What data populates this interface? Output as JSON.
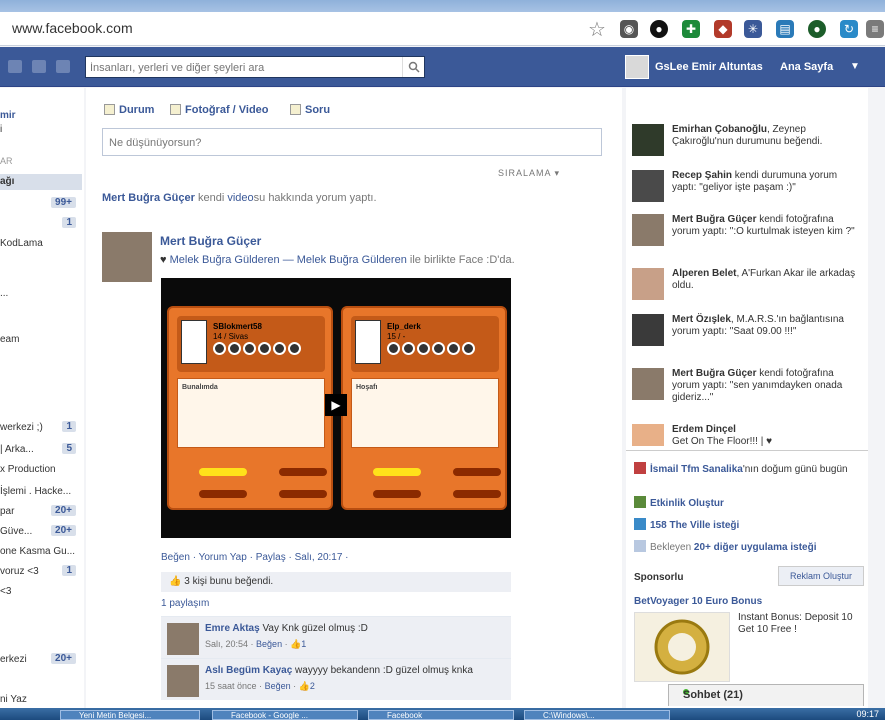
{
  "browser": {
    "url": "www.facebook.com"
  },
  "topbar": {
    "search_placeholder": "İnsanları, yerleri ve diğer şeyleri ara",
    "profile_name": "GsLee Emir Altuntas",
    "home_label": "Ana Sayfa"
  },
  "left": {
    "rows": [
      {
        "label": "mir",
        "count": ""
      },
      {
        "label": "i",
        "count": ""
      },
      {
        "label": "AR",
        "count": ""
      },
      {
        "label": "ağı",
        "count": ""
      },
      {
        "label": "",
        "count": "99+"
      },
      {
        "label": "",
        "count": "1"
      },
      {
        "label": "KodLama",
        "count": ""
      },
      {
        "label": "",
        "count": ""
      },
      {
        "label": "...",
        "count": ""
      },
      {
        "label": "eam",
        "count": ""
      },
      {
        "label": "werkezi ;)",
        "count": "1"
      },
      {
        "label": "| Arka...",
        "count": "5"
      },
      {
        "label": "x Production",
        "count": ""
      },
      {
        "label": "İşlemi . Hacke...",
        "count": ""
      },
      {
        "label": "par",
        "count": "20+"
      },
      {
        "label": "Güve...",
        "count": "20+"
      },
      {
        "label": "one Kasma Gu...",
        "count": ""
      },
      {
        "label": "voruz <3",
        "count": "1"
      },
      {
        "label": "<3",
        "count": ""
      },
      {
        "label": "erkezi",
        "count": "20+"
      },
      {
        "label": "ni Yaz",
        "count": ""
      }
    ]
  },
  "composer": {
    "tab_status": "Durum",
    "tab_photo": "Fotoğraf / Video",
    "tab_question": "Soru",
    "placeholder": "Ne düşünüyorsun?",
    "sort_label": "SIRALAMA"
  },
  "story1": {
    "actor": "Mert Buğra Güçer",
    "text_a": "kendi",
    "link": "video",
    "text_b": "su hakkında yorum yaptı."
  },
  "post": {
    "author": "Mert Buğra Güçer",
    "with_prefix": "♥",
    "with_link": "Melek Buğra Gülderen — Melek Buğra Gülderen",
    "with_suffix": "ile birlikte Face :D'da.",
    "video_left_name": "SBlokmert58",
    "video_left_level": "14 / Sivas",
    "video_right_name": "Elp_derk",
    "video_right_level": "15 / -",
    "video_left_section": "Bunalımda",
    "video_right_section": "Hoşafı",
    "actions": "Beğen · Yorum Yap · Paylaş · Salı, 20:17 ·",
    "likes": "3 kişi bunu beğendi.",
    "likes_link": "3 kişi",
    "shares": "1 paylaşım",
    "comments": [
      {
        "author": "Emre Aktaş",
        "text": "Vay Knk güzel olmuş :D",
        "meta": "Salı, 20:54 ·",
        "like": "Beğen",
        "count": "1"
      },
      {
        "author": "Aslı Begüm Kayaç",
        "text": "wayyyy bekandenn :D güzel olmuş knka",
        "meta": "15 saat önce ·",
        "like": "Beğen",
        "count": "2"
      }
    ]
  },
  "ticker": [
    {
      "name": "Emirhan Çobanoğlu",
      "text": ", Zeynep Çakıroğlu'nun durumunu beğendi."
    },
    {
      "name": "Recep Şahin",
      "text": " kendi durumuna yorum yaptı: \"geliyor işte paşam :)\""
    },
    {
      "name": "Mert Buğra Güçer",
      "text": " kendi fotoğrafına yorum yaptı: \":O kurtulmak isteyen kim ?\""
    },
    {
      "name": "Alperen Belet",
      "text": ", A'Furkan Akar ile arkadaş oldu."
    },
    {
      "name": "Mert Özışlek",
      "text": ", M.A.R.S.'ın bağlantısına yorum yaptı: \"Saat 09.00 !!!\""
    },
    {
      "name": "Mert Buğra Güçer",
      "text": " kendi fotoğrafına yorum yaptı: \"sen yanımdayken onada gideriz...\""
    },
    {
      "name": "Erdem Dinçel",
      "text": "Get On The Floor!!! | ♥"
    }
  ],
  "right": {
    "birthday_name": "İsmail Tfm Sanalika",
    "birthday_text": "'nın doğum günü bugün",
    "create_event": "Etkinlik Oluştur",
    "ville": "158 The Ville isteği",
    "pending_prefix": "Bekleyen",
    "pending": "20+ diğer uygulama isteği",
    "sponsored": "Sponsorlu",
    "create_ad": "Reklam Oluştur",
    "ad_title": "BetVoyager 10 Euro Bonus",
    "ad_text": "Instant Bonus: Deposit 10 Get 10 Free !",
    "chat": "Sohbet (21)"
  },
  "taskbar": {
    "tasks": [
      "Yeni Metin Belgesi...",
      "Facebook - Google ...",
      "Facebook",
      "C:\\Windows\\..."
    ],
    "clock": "09:17"
  },
  "colors": {
    "facebook_blue": "#3b5998",
    "video_orange": "#e8762a"
  }
}
